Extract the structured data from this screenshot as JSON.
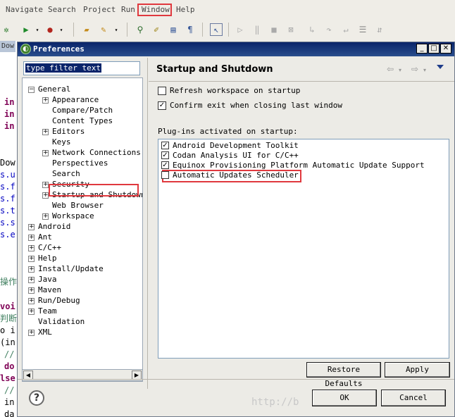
{
  "menubar": {
    "items": [
      "Navigate",
      "Search",
      "Project",
      "Run",
      "Window",
      "Help"
    ],
    "highlighted": "Window"
  },
  "editor": {
    "tab_label": "Dow",
    "lines": [
      "in",
      "in",
      "in",
      "Dow",
      "s.u",
      "s.f",
      "s.f",
      "s.t",
      "s.s",
      "s.e",
      "操作",
      "voi",
      "判断",
      "o i",
      "(in",
      "//",
      "do",
      "lse",
      "//",
      "in",
      "da"
    ]
  },
  "dialog": {
    "title": "Preferences",
    "filter": {
      "value": "type filter text"
    },
    "tree": [
      {
        "label": "General",
        "expander": "-",
        "level": 0
      },
      {
        "label": "Appearance",
        "expander": "+",
        "level": 1
      },
      {
        "label": "Compare/Patch",
        "expander": "",
        "level": 1
      },
      {
        "label": "Content Types",
        "expander": "",
        "level": 1
      },
      {
        "label": "Editors",
        "expander": "+",
        "level": 1
      },
      {
        "label": "Keys",
        "expander": "",
        "level": 1
      },
      {
        "label": "Network Connections",
        "expander": "+",
        "level": 1
      },
      {
        "label": "Perspectives",
        "expander": "",
        "level": 1
      },
      {
        "label": "Search",
        "expander": "",
        "level": 1
      },
      {
        "label": "Security",
        "expander": "+",
        "level": 1
      },
      {
        "label": "Startup and Shutdown",
        "expander": "+",
        "level": 1
      },
      {
        "label": "Web Browser",
        "expander": "",
        "level": 1
      },
      {
        "label": "Workspace",
        "expander": "+",
        "level": 1
      },
      {
        "label": "Android",
        "expander": "+",
        "level": 0
      },
      {
        "label": "Ant",
        "expander": "+",
        "level": 0
      },
      {
        "label": "C/C++",
        "expander": "+",
        "level": 0
      },
      {
        "label": "Help",
        "expander": "+",
        "level": 0
      },
      {
        "label": "Install/Update",
        "expander": "+",
        "level": 0
      },
      {
        "label": "Java",
        "expander": "+",
        "level": 0
      },
      {
        "label": "Maven",
        "expander": "+",
        "level": 0
      },
      {
        "label": "Run/Debug",
        "expander": "+",
        "level": 0
      },
      {
        "label": "Team",
        "expander": "+",
        "level": 0
      },
      {
        "label": "Validation",
        "expander": "",
        "level": 0
      },
      {
        "label": "XML",
        "expander": "+",
        "level": 0
      }
    ],
    "page": {
      "title": "Startup and Shutdown",
      "refresh_workspace": {
        "label": "Refresh workspace on startup",
        "checked": false
      },
      "confirm_exit": {
        "label": "Confirm exit when closing last window",
        "checked": true
      },
      "plugins_label": "Plug-ins activated on startup:",
      "plugins": [
        {
          "label": "Android Development Toolkit",
          "checked": true
        },
        {
          "label": "Codan Analysis UI for C/C++",
          "checked": true
        },
        {
          "label": "Equinox Provisioning Platform Automatic Update Support",
          "checked": true
        },
        {
          "label": "Automatic Updates Scheduler",
          "checked": false
        }
      ]
    },
    "buttons": {
      "restore_defaults": "Restore Defaults",
      "apply": "Apply",
      "ok": "OK",
      "cancel": "Cancel"
    },
    "watermark": "http://b"
  },
  "colors": {
    "highlight_box": "#e0393e",
    "title_bar": "#0a246a",
    "selection": "#0a246a"
  }
}
